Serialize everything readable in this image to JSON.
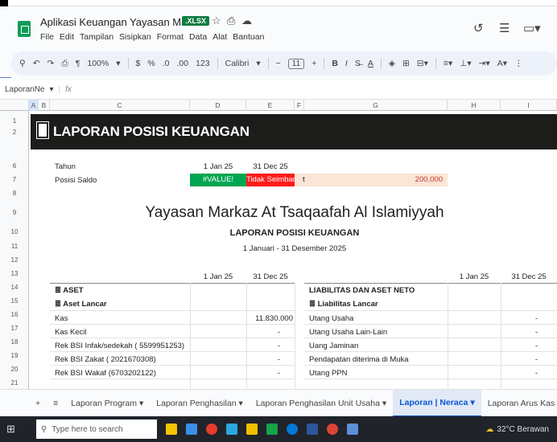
{
  "window": {
    "title": "Aplikasi Keuangan Yayasan Markaz",
    "badge": ".XLSX",
    "menus": [
      "File",
      "Edit",
      "Tampilan",
      "Sisipkan",
      "Format",
      "Data",
      "Alat",
      "Bantuan"
    ]
  },
  "toolbar": {
    "zoom": "100%",
    "currency": "$",
    "percent": "%",
    "dec_less": ".0",
    "dec_more": ".00",
    "number_fmt": "123",
    "font": "Calibri",
    "font_size": "11",
    "bold": "B",
    "italic": "I"
  },
  "formula_bar": {
    "name_box": "LaporanNe",
    "fx": "fx"
  },
  "columns": [
    "A",
    "B",
    "C",
    "D",
    "E",
    "F",
    "G",
    "H",
    "I"
  ],
  "rows": [
    "1",
    "2",
    "",
    "6",
    "7",
    "8",
    "9",
    "10",
    "11",
    "12",
    "13",
    "14",
    "15",
    "16",
    "17",
    "18",
    "19",
    "20",
    "21"
  ],
  "banner": {
    "title": "LAPORAN POSISI KEUANGAN"
  },
  "summary": {
    "tahun_label": "Tahun",
    "tahun_d": "1 Jan 25",
    "tahun_e": "31 Dec 25",
    "saldo_label": "Posisi Saldo",
    "saldo_d": "#VALUE!",
    "saldo_e": "Tidak Seimbang",
    "saldo_f": "t",
    "saldo_g": "200,000"
  },
  "report": {
    "org": "Yayasan Markaz At Tsaqaafah Al Islamiyyah",
    "title": "LAPORAN POSISI KEUANGAN",
    "period": "1 Januari - 31 Desember 2025"
  },
  "table": {
    "col1": "1 Jan 25",
    "col2": "31 Dec 25",
    "col3": "1 Jan 25",
    "col4": "31 Dec 25",
    "left_header": "ASET",
    "left_sub": "Aset Lancar",
    "left_rows": [
      [
        "Kas",
        "",
        "11.830.000"
      ],
      [
        "Kas Kecil",
        "",
        "-"
      ],
      [
        "Rek BSI Infak/sedekah ( 5599951253)",
        "",
        "-"
      ],
      [
        "Rek BSI Zakat ( 2021670308)",
        "",
        "-"
      ],
      [
        "Rek BSI Wakaf (6703202122)",
        "",
        "-"
      ]
    ],
    "right_header": "LIABILITAS DAN ASET NETO",
    "right_sub": "Liabilitas Lancar",
    "right_rows": [
      [
        "Utang Usaha",
        "",
        "-"
      ],
      [
        "Utang Usaha Lain-Lain",
        "",
        "-"
      ],
      [
        "Uang Jaminan",
        "",
        "-"
      ],
      [
        "Pendapatan diterima di Muka",
        "",
        "-"
      ],
      [
        "Utang PPN",
        "",
        "-"
      ]
    ]
  },
  "tabs": [
    "Laporan Program",
    "Laporan Penghasilan",
    "Laporan Penghasilan Unit Usaha",
    "Laporan | Neraca",
    "Laporan Arus Kas Bulanan"
  ],
  "active_tab": "Laporan | Neraca",
  "taskbar": {
    "search_placeholder": "Type here to search",
    "weather": "32°C Berawan"
  }
}
